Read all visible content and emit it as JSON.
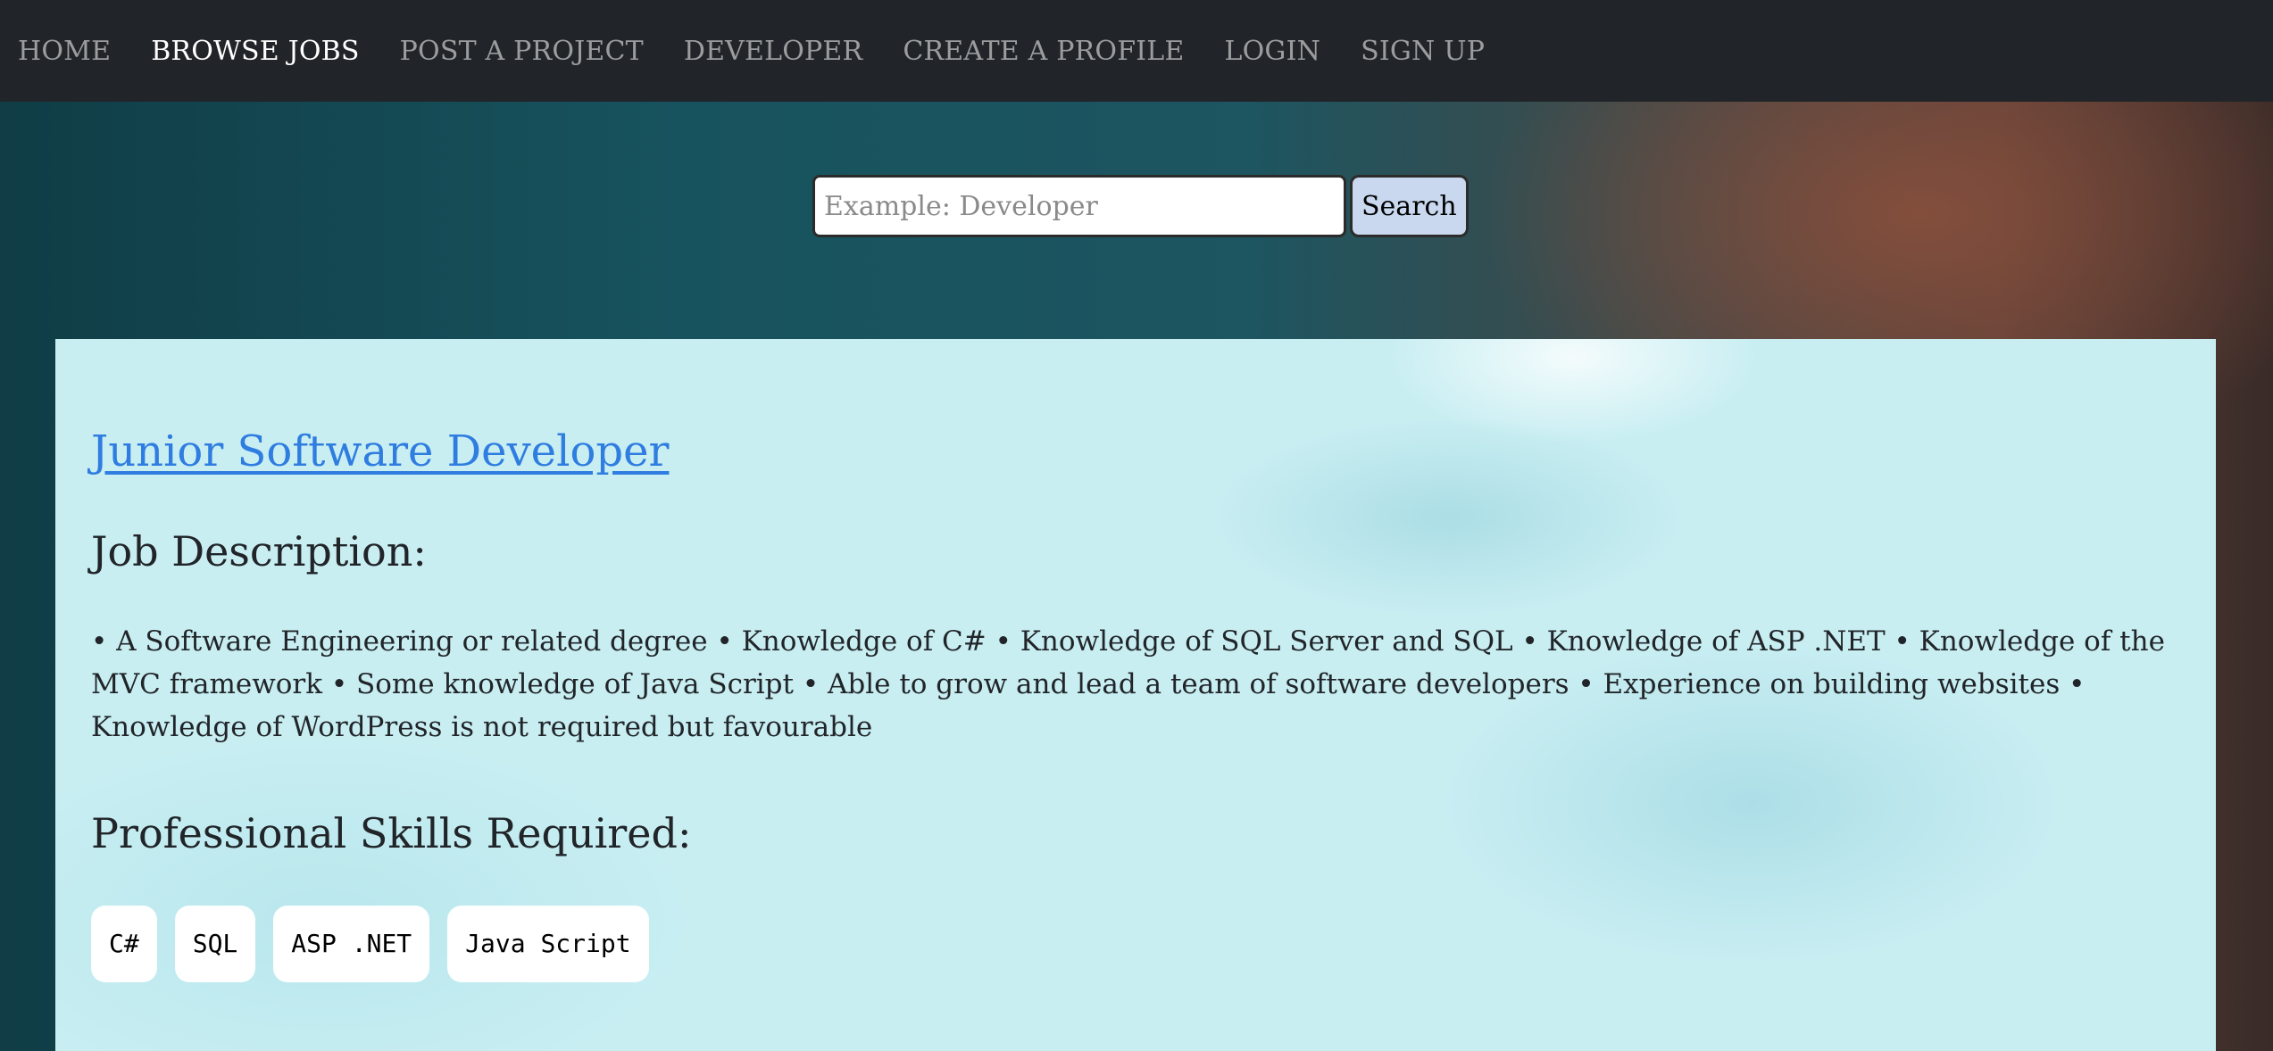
{
  "nav": {
    "items": [
      {
        "label": "HOME"
      },
      {
        "label": "BROWSE JOBS"
      },
      {
        "label": "POST A PROJECT"
      },
      {
        "label": "DEVELOPER"
      },
      {
        "label": "CREATE A PROFILE"
      },
      {
        "label": "LOGIN"
      },
      {
        "label": "SIGN UP"
      }
    ],
    "active": "BROWSE JOBS"
  },
  "search": {
    "placeholder": "Example: Developer",
    "value": "",
    "button_label": "Search"
  },
  "job": {
    "title": "Junior Software Developer",
    "description_heading": "Job Description:",
    "description": "• A Software Engineering or related degree • Knowledge of C# • Knowledge of SQL Server and SQL • Knowledge of ASP .NET • Knowledge of the MVC framework • Some knowledge of Java Script • Able to grow and lead a team of software developers • Experience on building websites • Knowledge of WordPress is not required but favourable",
    "skills_heading": "Professional Skills Required:",
    "skills": [
      "C#",
      "SQL",
      "ASP .NET",
      "Java Script"
    ]
  },
  "colors": {
    "navbar_bg": "#212529",
    "link": "#2f7de0",
    "card_bg": "#c8eef2",
    "search_button_bg": "#c9d8ee"
  }
}
